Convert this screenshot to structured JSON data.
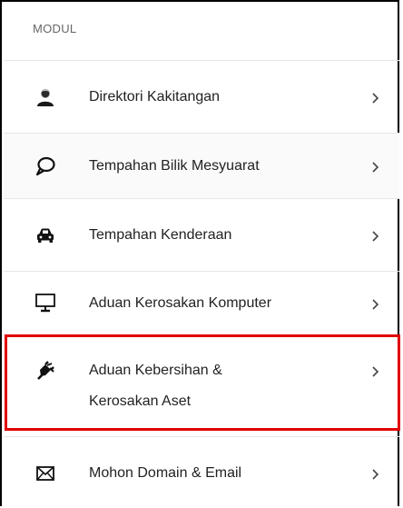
{
  "section": {
    "title": "MODUL"
  },
  "menu": {
    "items": [
      {
        "label": "Direktori Kakitangan",
        "icon": "user-icon"
      },
      {
        "label": "Tempahan Bilik Mesyuarat",
        "icon": "speech-bubble-icon"
      },
      {
        "label": "Tempahan Kenderaan",
        "icon": "car-icon"
      },
      {
        "label": "Aduan Kerosakan Komputer",
        "icon": "monitor-icon"
      },
      {
        "label_line1": "Aduan Kebersihan &",
        "label_line2": "Kerosakan Aset",
        "icon": "plug-icon",
        "highlighted": true
      },
      {
        "label": "Mohon Domain & Email",
        "icon": "envelope-icon"
      }
    ]
  },
  "colors": {
    "highlight": "#e00000",
    "text": "#222222",
    "muted": "#666666"
  }
}
